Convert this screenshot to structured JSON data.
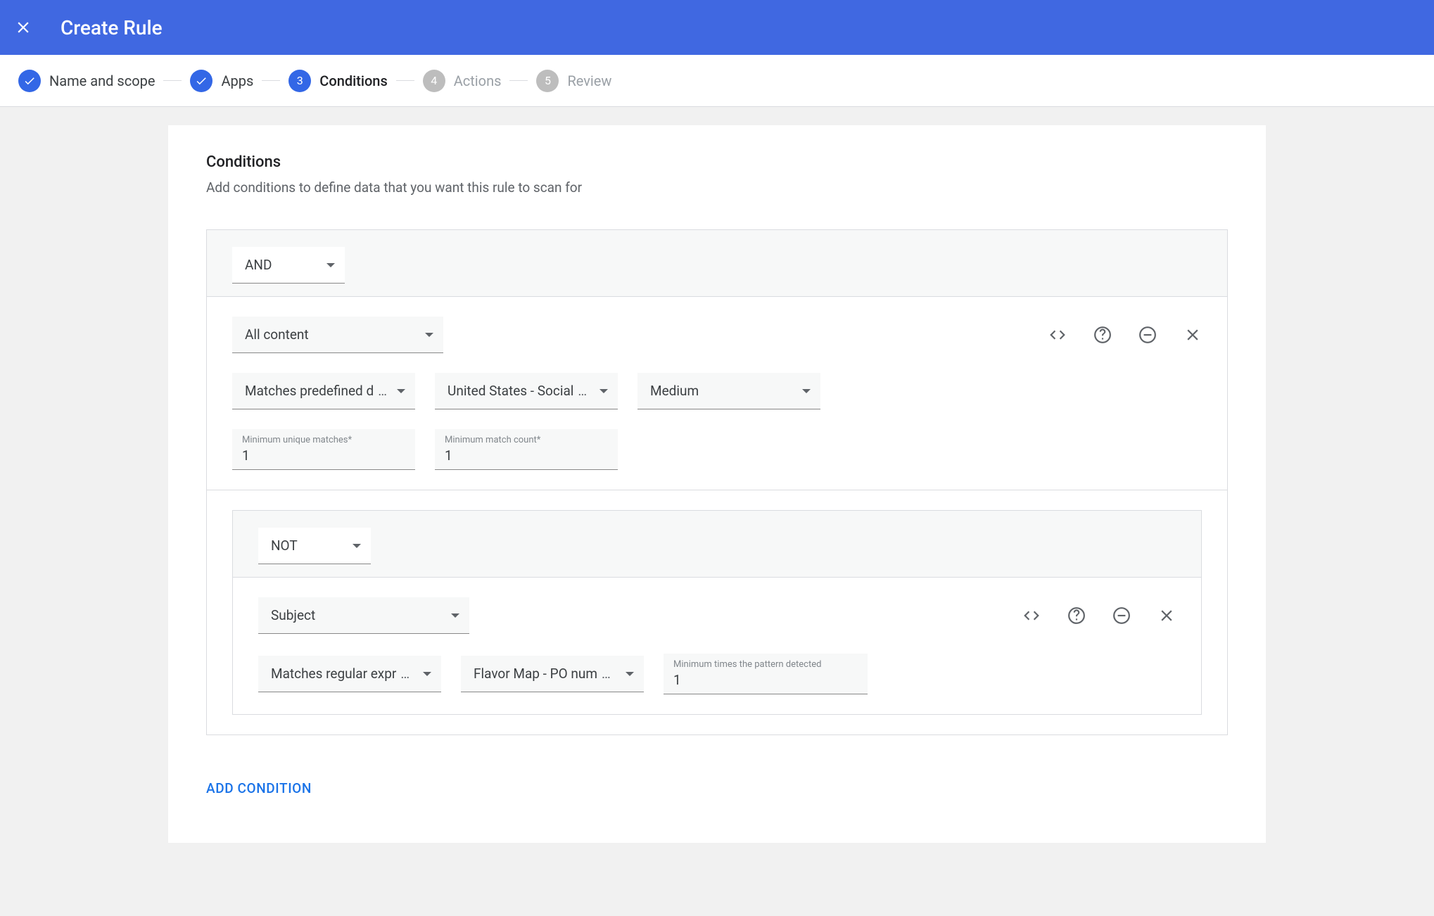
{
  "header": {
    "title": "Create Rule"
  },
  "steps": [
    {
      "label": "Name and scope",
      "state": "done"
    },
    {
      "label": "Apps",
      "state": "done"
    },
    {
      "label": "Conditions",
      "state": "active",
      "number": "3"
    },
    {
      "label": "Actions",
      "state": "pending",
      "number": "4"
    },
    {
      "label": "Review",
      "state": "pending",
      "number": "5"
    }
  ],
  "section": {
    "title": "Conditions",
    "subtitle": "Add conditions to define data that you want this rule to scan for"
  },
  "group1": {
    "operator": "AND",
    "cond1": {
      "scope": "All content",
      "matchType": "Matches predefined d",
      "detector": "United States - Social",
      "confidence": "Medium",
      "minUniqueLabel": "Minimum unique matches*",
      "minUniqueValue": "1",
      "minCountLabel": "Minimum match count*",
      "minCountValue": "1"
    },
    "nested": {
      "operator": "NOT",
      "cond": {
        "scope": "Subject",
        "matchType": "Matches regular expr",
        "detector": "Flavor Map - PO num",
        "minTimesLabel": "Minimum times the pattern detected",
        "minTimesValue": "1"
      }
    }
  },
  "addConditionLabel": "ADD CONDITION"
}
